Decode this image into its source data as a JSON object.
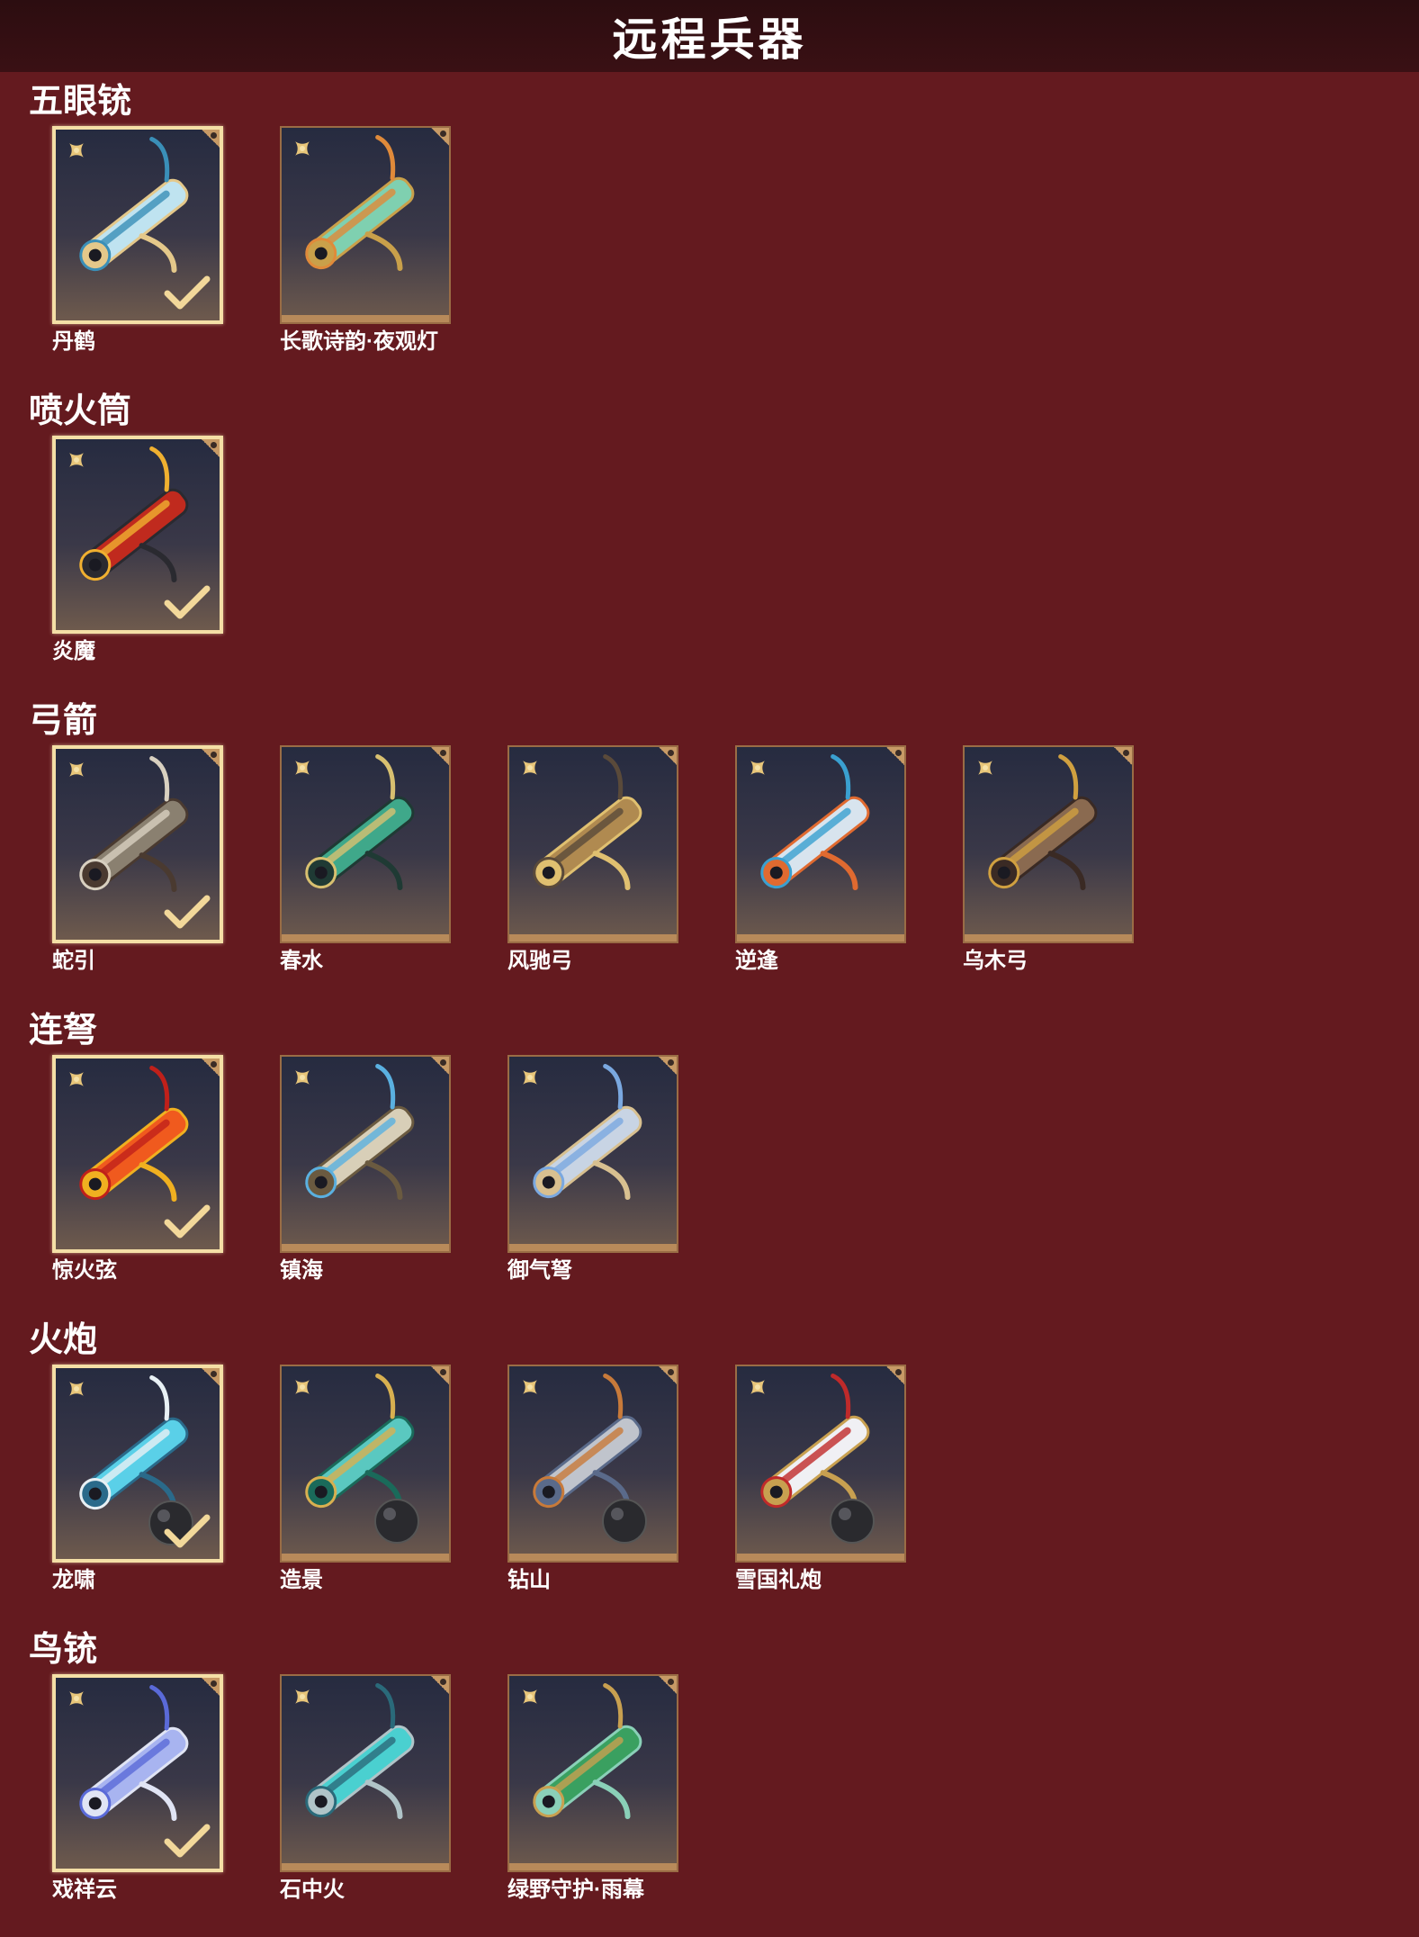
{
  "header": {
    "title": "远程兵器"
  },
  "colors": {
    "background": "#641a1f",
    "header": "#2c0d10",
    "card_border": "#9a6c45",
    "selected_border": "#f4dfa6",
    "check": "#f2d89a"
  },
  "sections": [
    {
      "title": "五眼铳",
      "items": [
        {
          "name": "丹鹤",
          "selected": true,
          "palette": [
            "#bfe3f0",
            "#3a8fb8",
            "#e4c88a"
          ],
          "cannonball": false
        },
        {
          "name": "长歌诗韵·夜观灯",
          "selected": false,
          "palette": [
            "#7fd0b0",
            "#e08a3a",
            "#c9a04a"
          ],
          "cannonball": false
        }
      ]
    },
    {
      "title": "喷火筒",
      "items": [
        {
          "name": "炎魔",
          "selected": true,
          "palette": [
            "#c02a1e",
            "#f0b030",
            "#2a2a30"
          ],
          "cannonball": false
        }
      ]
    },
    {
      "title": "弓箭",
      "items": [
        {
          "name": "蛇引",
          "selected": true,
          "palette": [
            "#8a8070",
            "#d8d0c0",
            "#4a3a30"
          ],
          "cannonball": false
        },
        {
          "name": "春水",
          "selected": false,
          "palette": [
            "#3fa88a",
            "#d8c070",
            "#1f3a34"
          ],
          "cannonball": false
        },
        {
          "name": "风驰弓",
          "selected": false,
          "palette": [
            "#b08a50",
            "#5a4a3a",
            "#e0c070"
          ],
          "cannonball": false
        },
        {
          "name": "逆逢",
          "selected": false,
          "palette": [
            "#d8e4ee",
            "#3aa0d0",
            "#e06a30"
          ],
          "cannonball": false
        },
        {
          "name": "乌木弓",
          "selected": false,
          "palette": [
            "#8a6a50",
            "#d0a040",
            "#3a2a24"
          ],
          "cannonball": false
        }
      ]
    },
    {
      "title": "连弩",
      "items": [
        {
          "name": "惊火弦",
          "selected": true,
          "palette": [
            "#f05a1e",
            "#c0201a",
            "#f0b020"
          ],
          "cannonball": false
        },
        {
          "name": "镇海",
          "selected": false,
          "palette": [
            "#d8cfb8",
            "#5ab0e0",
            "#6a5a40"
          ],
          "cannonball": false
        },
        {
          "name": "御气弩",
          "selected": false,
          "palette": [
            "#c8d4e4",
            "#7aa8e0",
            "#d8c090"
          ],
          "cannonball": false
        }
      ]
    },
    {
      "title": "火炮",
      "items": [
        {
          "name": "龙啸",
          "selected": true,
          "palette": [
            "#5ad0e8",
            "#e8f0f4",
            "#2a6a8a"
          ],
          "cannonball": true
        },
        {
          "name": "造景",
          "selected": false,
          "palette": [
            "#5ac8c0",
            "#d8b050",
            "#1a6a5a"
          ],
          "cannonball": true
        },
        {
          "name": "钻山",
          "selected": false,
          "palette": [
            "#c0c4cc",
            "#c87a3a",
            "#5a6a8a"
          ],
          "cannonball": true
        },
        {
          "name": "雪国礼炮",
          "selected": false,
          "palette": [
            "#f0f0f4",
            "#c02a2a",
            "#c8a050"
          ],
          "cannonball": true
        }
      ]
    },
    {
      "title": "鸟铳",
      "items": [
        {
          "name": "戏祥云",
          "selected": true,
          "palette": [
            "#a8b4f0",
            "#5a6ad8",
            "#e0e4f4"
          ],
          "cannonball": false
        },
        {
          "name": "石中火",
          "selected": false,
          "palette": [
            "#4ad0d0",
            "#2a6a7a",
            "#b0c4c8"
          ],
          "cannonball": false
        },
        {
          "name": "绿野守护·雨幕",
          "selected": false,
          "palette": [
            "#3aa060",
            "#c8a050",
            "#8ad0b8"
          ],
          "cannonball": false
        }
      ]
    }
  ]
}
